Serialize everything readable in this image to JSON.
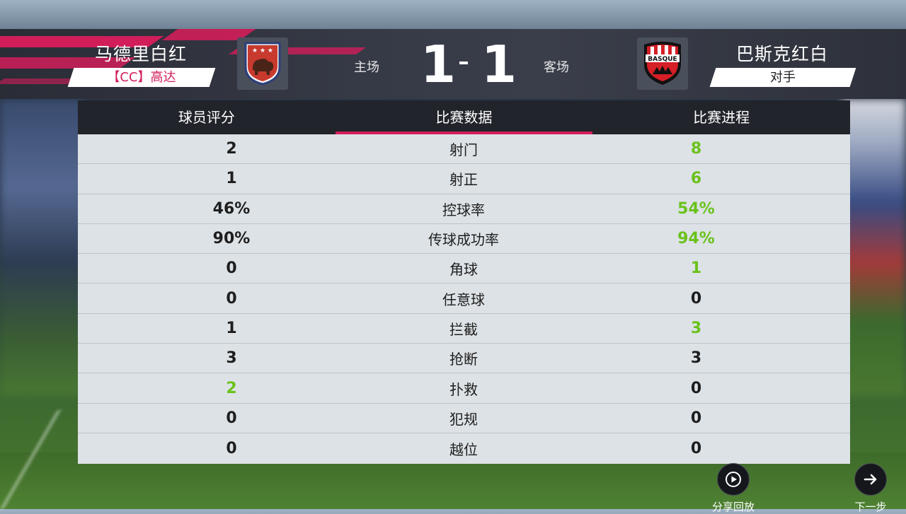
{
  "match": {
    "home": {
      "name": "马德里白红",
      "label": "【CC】高达",
      "side": "主场",
      "score": "1"
    },
    "away": {
      "name": "巴斯克红白",
      "label": "对手",
      "side": "客场",
      "score": "1",
      "crest_text": "BASQUE"
    }
  },
  "tabs": [
    {
      "label": "球员评分",
      "active": false
    },
    {
      "label": "比赛数据",
      "active": true
    },
    {
      "label": "比赛进程",
      "active": false
    }
  ],
  "stats": [
    {
      "label": "射门",
      "home": "2",
      "away": "8",
      "highlight": "away"
    },
    {
      "label": "射正",
      "home": "1",
      "away": "6",
      "highlight": "away"
    },
    {
      "label": "控球率",
      "home": "46%",
      "away": "54%",
      "highlight": "away"
    },
    {
      "label": "传球成功率",
      "home": "90%",
      "away": "94%",
      "highlight": "away"
    },
    {
      "label": "角球",
      "home": "0",
      "away": "1",
      "highlight": "away"
    },
    {
      "label": "任意球",
      "home": "0",
      "away": "0",
      "highlight": "none"
    },
    {
      "label": "拦截",
      "home": "1",
      "away": "3",
      "highlight": "away"
    },
    {
      "label": "抢断",
      "home": "3",
      "away": "3",
      "highlight": "none"
    },
    {
      "label": "扑救",
      "home": "2",
      "away": "0",
      "highlight": "home"
    },
    {
      "label": "犯规",
      "home": "0",
      "away": "0",
      "highlight": "none"
    },
    {
      "label": "越位",
      "home": "0",
      "away": "0",
      "highlight": "none"
    }
  ],
  "actions": {
    "replay": {
      "label": "分享回放",
      "icon": "play-icon"
    },
    "next": {
      "label": "下一步",
      "icon": "arrow-right-icon"
    }
  },
  "colors": {
    "accent": "#d11e5a",
    "highlight": "#6ac21b",
    "table_bg": "#dde2e6",
    "header_bg": "#22242b"
  }
}
